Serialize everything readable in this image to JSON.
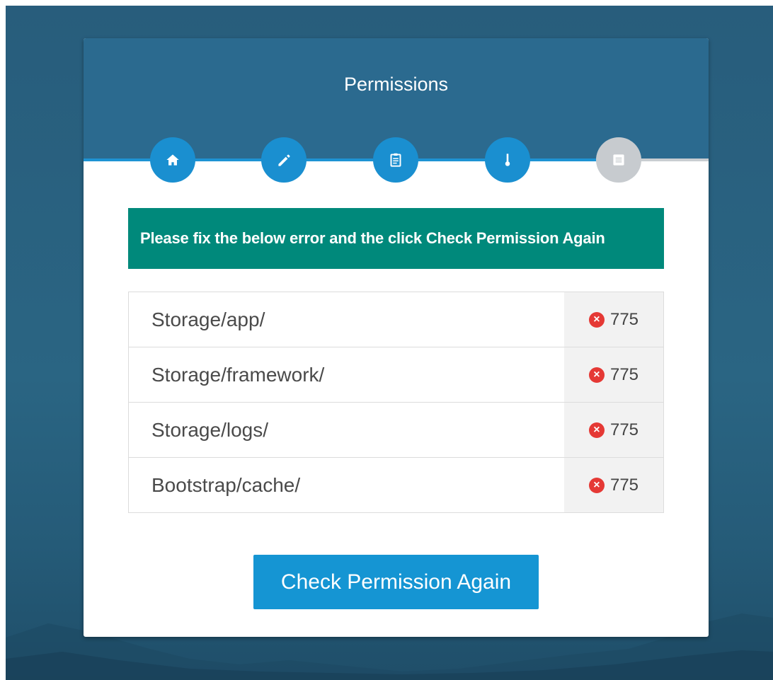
{
  "wizard": {
    "title": "Permissions",
    "steps": [
      {
        "icon": "home-icon",
        "state": "done"
      },
      {
        "icon": "pencil-icon",
        "state": "done"
      },
      {
        "icon": "clipboard-icon",
        "state": "done"
      },
      {
        "icon": "key-icon",
        "state": "done"
      },
      {
        "icon": "list-icon",
        "state": "todo"
      }
    ],
    "colors": {
      "header": "#2b6a8f",
      "step_active": "#1a8fd0",
      "step_inactive": "#c7cbcf",
      "alert": "#00897b",
      "button": "#1595d3",
      "error": "#e53935"
    }
  },
  "alert": {
    "message": "Please fix the below error and the click Check Permission Again"
  },
  "permissions": [
    {
      "path": "Storage/app/",
      "status_icon": "error-icon",
      "value": "775"
    },
    {
      "path": "Storage/framework/",
      "status_icon": "error-icon",
      "value": "775"
    },
    {
      "path": "Storage/logs/",
      "status_icon": "error-icon",
      "value": "775"
    },
    {
      "path": "Bootstrap/cache/",
      "status_icon": "error-icon",
      "value": "775"
    }
  ],
  "actions": {
    "check_again_label": "Check Permission Again"
  }
}
